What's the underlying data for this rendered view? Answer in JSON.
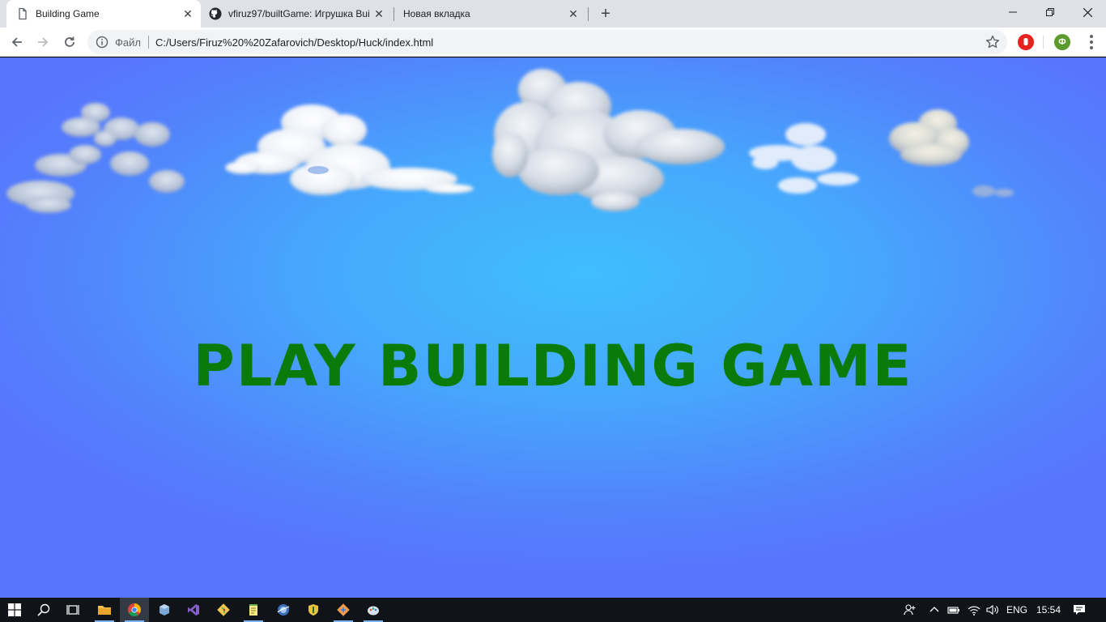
{
  "browser": {
    "tabs": [
      {
        "title": "Building Game",
        "active": true
      },
      {
        "title": "vfiruz97/builtGame: Игрушка Bui",
        "active": false
      },
      {
        "title": "Новая вкладка",
        "active": false
      }
    ],
    "window_controls": {
      "minimize": "—",
      "restore": "❐",
      "close": "✕"
    },
    "address": {
      "scheme_label": "Файл",
      "url": "C:/Users/Firuz%20%20Zafarovich/Desktop/Huck/index.html"
    },
    "profile_initial": "Ф",
    "colors": {
      "tabstrip": "#dee1e6",
      "omnibox": "#f1f3f4",
      "profile": "#5b9a2d",
      "adblock": "#e8231f"
    }
  },
  "page": {
    "title_text": "PLAY BUILDING GAME",
    "colors": {
      "sky_center": "#3fbefd",
      "sky_edge": "#5876fd",
      "title": "#0a7a08"
    }
  },
  "taskbar": {
    "pinned": [
      {
        "icon": "file-explorer-icon",
        "running": true,
        "active": false
      },
      {
        "icon": "chrome-icon",
        "running": true,
        "active": true
      },
      {
        "icon": "cube-app-icon",
        "running": false,
        "active": false
      },
      {
        "icon": "visual-studio-icon",
        "running": false,
        "active": false
      },
      {
        "icon": "git-icon",
        "running": false,
        "active": false
      },
      {
        "icon": "notepad-icon",
        "running": true,
        "active": false
      },
      {
        "icon": "browser-globe-icon",
        "running": false,
        "active": false
      },
      {
        "icon": "shield-app-icon",
        "running": false,
        "active": false
      },
      {
        "icon": "sourcetree-icon",
        "running": true,
        "active": false
      },
      {
        "icon": "paint-icon",
        "running": true,
        "active": false
      }
    ],
    "tray": {
      "language": "ENG",
      "time": "15:54"
    }
  }
}
